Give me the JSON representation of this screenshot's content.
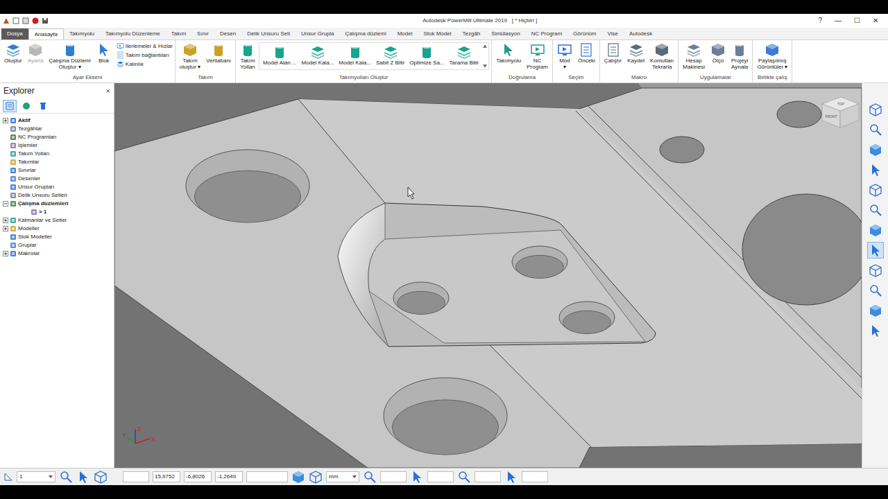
{
  "window": {
    "title": "Autodesk PowerMill Ultimate 2019   [ * Hiçbiri ]",
    "controls": [
      "?",
      "—",
      "☐",
      "✕"
    ]
  },
  "tabs": [
    {
      "label": "Dosya",
      "selected": false,
      "kind": "file"
    },
    {
      "label": "Anasayfa",
      "selected": true,
      "kind": "tab"
    },
    {
      "label": "Takımyolu",
      "selected": false,
      "kind": "tab"
    },
    {
      "label": "Takımyolu Düzenleme",
      "selected": false,
      "kind": "tab"
    },
    {
      "label": "Takım",
      "selected": false,
      "kind": "tab"
    },
    {
      "label": "Sınır",
      "selected": false,
      "kind": "tab"
    },
    {
      "label": "Desen",
      "selected": false,
      "kind": "tab"
    },
    {
      "label": "Delik Unsuru Seti",
      "selected": false,
      "kind": "tab"
    },
    {
      "label": "Unsur Grupla",
      "selected": false,
      "kind": "tab"
    },
    {
      "label": "Çalışma düzlemi",
      "selected": false,
      "kind": "tab"
    },
    {
      "label": "Model",
      "selected": false,
      "kind": "tab"
    },
    {
      "label": "Stok Model",
      "selected": false,
      "kind": "tab"
    },
    {
      "label": "Tezgâh",
      "selected": false,
      "kind": "tab"
    },
    {
      "label": "Simülasyon",
      "selected": false,
      "kind": "tab"
    },
    {
      "label": "NC Program",
      "selected": false,
      "kind": "tab"
    },
    {
      "label": "Görünüm",
      "selected": false,
      "kind": "tab"
    },
    {
      "label": "Vise",
      "selected": false,
      "kind": "tab"
    },
    {
      "label": "Autodesk",
      "selected": false,
      "kind": "tab"
    }
  ],
  "ribbon": [
    {
      "label": "Ayar Ekseni",
      "buttons": [
        {
          "lines": [
            "Oluştur"
          ],
          "kind": "large",
          "disabled": false
        },
        {
          "lines": [
            "Ayarla"
          ],
          "kind": "large",
          "disabled": true
        },
        {
          "lines": [
            "Çalışma Düzlemi",
            "Oluştur ▾"
          ],
          "kind": "large",
          "disabled": false
        },
        {
          "lines": [
            "Blok"
          ],
          "kind": "large",
          "disabled": false
        },
        {
          "lines": [
            "İlerlemeler & Hızlar"
          ],
          "kind": "small",
          "disabled": false
        },
        {
          "lines": [
            "Takım bağlantıları"
          ],
          "kind": "small",
          "disabled": false
        },
        {
          "lines": [
            "Kalınlık"
          ],
          "kind": "small",
          "disabled": false
        }
      ]
    },
    {
      "label": "Takım",
      "buttons": [
        {
          "lines": [
            "Takım",
            "oluştur ▾"
          ],
          "kind": "large",
          "disabled": false
        },
        {
          "lines": [
            "Veritabanı"
          ],
          "kind": "large",
          "disabled": false
        }
      ]
    },
    {
      "label": "Takımyolları Oluştur",
      "buttons": [
        {
          "lines": [
            "Takım",
            "Yolları"
          ],
          "kind": "large",
          "disabled": false
        },
        {
          "lines": [
            "Model Alan ..."
          ],
          "kind": "gallery",
          "disabled": false
        },
        {
          "lines": [
            "Model Kala..."
          ],
          "kind": "gallery",
          "disabled": false
        },
        {
          "lines": [
            "Model Kala..."
          ],
          "kind": "gallery",
          "disabled": false
        },
        {
          "lines": [
            "Sabit Z Bitir"
          ],
          "kind": "gallery",
          "disabled": false
        },
        {
          "lines": [
            "Optimize Sa..."
          ],
          "kind": "gallery",
          "disabled": false
        },
        {
          "lines": [
            "Tarama Bitir"
          ],
          "kind": "gallery",
          "disabled": false
        }
      ]
    },
    {
      "label": "Doğrulama",
      "buttons": [
        {
          "lines": [
            "Takımyolu"
          ],
          "kind": "large",
          "disabled": false
        },
        {
          "lines": [
            "NC",
            "Program"
          ],
          "kind": "large",
          "disabled": false
        }
      ]
    },
    {
      "label": "Seçim",
      "buttons": [
        {
          "lines": [
            "Mod",
            "▾"
          ],
          "kind": "large",
          "disabled": false
        },
        {
          "lines": [
            "Önceki"
          ],
          "kind": "large",
          "disabled": false
        }
      ]
    },
    {
      "label": "Makro",
      "buttons": [
        {
          "lines": [
            "Çalıştır"
          ],
          "kind": "large",
          "disabled": false
        },
        {
          "lines": [
            "Kaydet"
          ],
          "kind": "large",
          "disabled": false
        },
        {
          "lines": [
            "Komutları",
            "Tekrarla"
          ],
          "kind": "large",
          "disabled": false
        }
      ]
    },
    {
      "label": "Uygulamalar",
      "buttons": [
        {
          "lines": [
            "Hesap",
            "Makinesi"
          ],
          "kind": "large",
          "disabled": false
        },
        {
          "lines": [
            "Ölçü"
          ],
          "kind": "large",
          "disabled": false
        },
        {
          "lines": [
            "Projeyi",
            "Aynala"
          ],
          "kind": "large",
          "disabled": false
        }
      ]
    },
    {
      "label": "Birlikte çalış",
      "buttons": [
        {
          "lines": [
            "Paylaşılmış",
            "Görüntüler ▾"
          ],
          "kind": "large",
          "disabled": false
        }
      ]
    }
  ],
  "explorer": {
    "title": "Explorer",
    "close": "×",
    "view_buttons": [
      {
        "selected": true
      },
      {
        "selected": false
      },
      {
        "selected": false
      }
    ],
    "items": [
      {
        "label": "Aktif",
        "level": 0,
        "expandable": true,
        "expanded": false,
        "bold": true,
        "marker": ""
      },
      {
        "label": "Tezgâhlar",
        "level": 0,
        "expandable": false,
        "expanded": false,
        "bold": false,
        "marker": ""
      },
      {
        "label": "NC Programları",
        "level": 0,
        "expandable": false,
        "expanded": false,
        "bold": false,
        "marker": ""
      },
      {
        "label": "İşlemler",
        "level": 0,
        "expandable": false,
        "expanded": false,
        "bold": false,
        "marker": ""
      },
      {
        "label": "Takım Yolları",
        "level": 0,
        "expandable": false,
        "expanded": false,
        "bold": false,
        "marker": ""
      },
      {
        "label": "Takımlar",
        "level": 0,
        "expandable": false,
        "expanded": false,
        "bold": false,
        "marker": ""
      },
      {
        "label": "Sınırlar",
        "level": 0,
        "expandable": false,
        "expanded": false,
        "bold": false,
        "marker": ""
      },
      {
        "label": "Desenler",
        "level": 0,
        "expandable": false,
        "expanded": false,
        "bold": false,
        "marker": ""
      },
      {
        "label": "Unsur Grupları",
        "level": 0,
        "expandable": false,
        "expanded": false,
        "bold": false,
        "marker": ""
      },
      {
        "label": "Delik Unsuru Setleri",
        "level": 0,
        "expandable": false,
        "expanded": false,
        "bold": false,
        "marker": ""
      },
      {
        "label": "Çalışma düzlemleri",
        "level": 0,
        "expandable": true,
        "expanded": true,
        "bold": true,
        "marker": ""
      },
      {
        "label": "1",
        "level": 1,
        "expandable": false,
        "expanded": false,
        "bold": true,
        "marker": ">"
      },
      {
        "label": "Katmanlar ve Setler",
        "level": 0,
        "expandable": true,
        "expanded": false,
        "bold": false,
        "marker": ""
      },
      {
        "label": "Modeller",
        "level": 0,
        "expandable": true,
        "expanded": false,
        "bold": false,
        "marker": ""
      },
      {
        "label": "Stok Modeller",
        "level": 0,
        "expandable": false,
        "expanded": false,
        "bold": false,
        "marker": ""
      },
      {
        "label": "Gruplar",
        "level": 0,
        "expandable": false,
        "expanded": false,
        "bold": false,
        "marker": ""
      },
      {
        "label": "Makrolar",
        "level": 0,
        "expandable": true,
        "expanded": false,
        "bold": false,
        "marker": ""
      }
    ]
  },
  "viewport": {
    "axes": {
      "x": "X",
      "y": "Y",
      "z": "Z"
    },
    "view_cube": {
      "top": "TOP",
      "front": "FRONT"
    }
  },
  "view_tools": [
    {
      "selected": false
    },
    {
      "selected": false
    },
    {
      "selected": false
    },
    {
      "selected": false
    },
    {
      "selected": false
    },
    {
      "selected": false
    },
    {
      "selected": false
    },
    {
      "selected": true
    },
    {
      "selected": false
    },
    {
      "selected": false
    },
    {
      "selected": false
    },
    {
      "selected": false
    }
  ],
  "status_bar": {
    "workplane": "1",
    "coordinates": [
      "15,9752",
      "-6,8026",
      "-1,2649"
    ],
    "units": "mm"
  }
}
